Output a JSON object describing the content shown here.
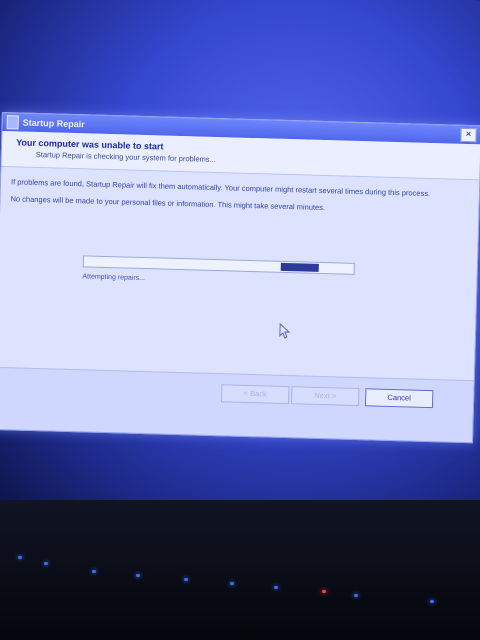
{
  "window": {
    "title": "Startup Repair",
    "close_glyph": "×"
  },
  "header": {
    "heading": "Your computer was unable to start",
    "subheading": "Startup Repair is checking your system for problems..."
  },
  "content": {
    "paragraph1": "If problems are found, Startup Repair will fix them automatically. Your computer might restart several times during this process.",
    "paragraph2": "No changes will be made to your personal files or information. This might take several minutes.",
    "progress_fraction": 0.85,
    "status": "Attempting repairs..."
  },
  "buttons": {
    "back": "< Back",
    "next": "Next >",
    "cancel": "Cancel"
  },
  "icons": {
    "title_icon": "startup-repair-icon",
    "cursor": "mouse-pointer-icon"
  },
  "colors": {
    "title_bar": "#4f66ea",
    "heading": "#1b2bb0",
    "progress_fill": "#2c3a9a"
  }
}
